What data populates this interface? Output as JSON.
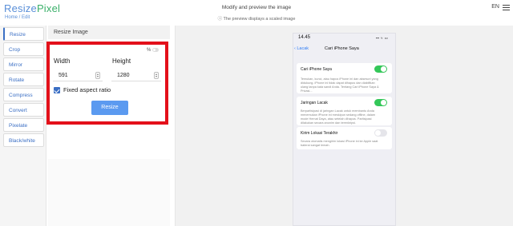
{
  "header": {
    "logo_part1": "Resize",
    "logo_part2": "Pixel",
    "breadcrumb": "Home / Edit",
    "title": "Modify and preview the image",
    "subtitle": "ⓘ The preview displays a scaled image",
    "language": "EN"
  },
  "sidebar": {
    "items": [
      {
        "label": "Resize"
      },
      {
        "label": "Crop"
      },
      {
        "label": "Mirror"
      },
      {
        "label": "Rotate"
      },
      {
        "label": "Compress"
      },
      {
        "label": "Convert"
      },
      {
        "label": "Pixelate"
      },
      {
        "label": "Black/white"
      }
    ],
    "active": "Resize"
  },
  "panel": {
    "title": "Resize Image",
    "percent_toggle_label": "%",
    "width_label": "Width",
    "height_label": "Height",
    "width_value": "591",
    "height_value": "1280",
    "aspect_label": "Fixed aspect ratio",
    "aspect_checked": true,
    "resize_button": "Resize"
  },
  "preview": {
    "time": "14.45",
    "status": "▪▪ ≈ ▭",
    "back": "‹ Lacak",
    "title": "Cari iPhone Saya",
    "cards": [
      {
        "title": "Cari iPhone Saya",
        "toggle": "on",
        "desc": [
          "Temukan, kunci, atau hapus iPhone ini dan aksesori yang",
          "didukung. iPhone ini tidak dapat dihapus dan diaktifkan",
          "ulang tanpa kata sandi Anda. Tentang Cari iPhone Saya &",
          "Privasi..."
        ]
      },
      {
        "title": "Jaringan Lacak",
        "toggle": "on",
        "desc": [
          "Berpartisipasi di jaringan Lacak untuk membantu Anda",
          "menemukan iPhone ini meskipun sedang offline, dalam",
          "mode Hemat Daya, atau setelah dihapus. Partisipasi",
          "dilakukan secara anonim dan terenkripsi."
        ]
      },
      {
        "title": "Kirim Lokasi Terakhir",
        "toggle": "off",
        "desc": [
          "Secara otomatis mengirim lokasi iPhone ini ke Apple saat",
          "baterai sangat lemah."
        ]
      }
    ]
  },
  "colors": {
    "accent": "#3b6fc4",
    "button": "#5b9af0",
    "highlight": "#e3101a",
    "toggle_on": "#34c759"
  }
}
